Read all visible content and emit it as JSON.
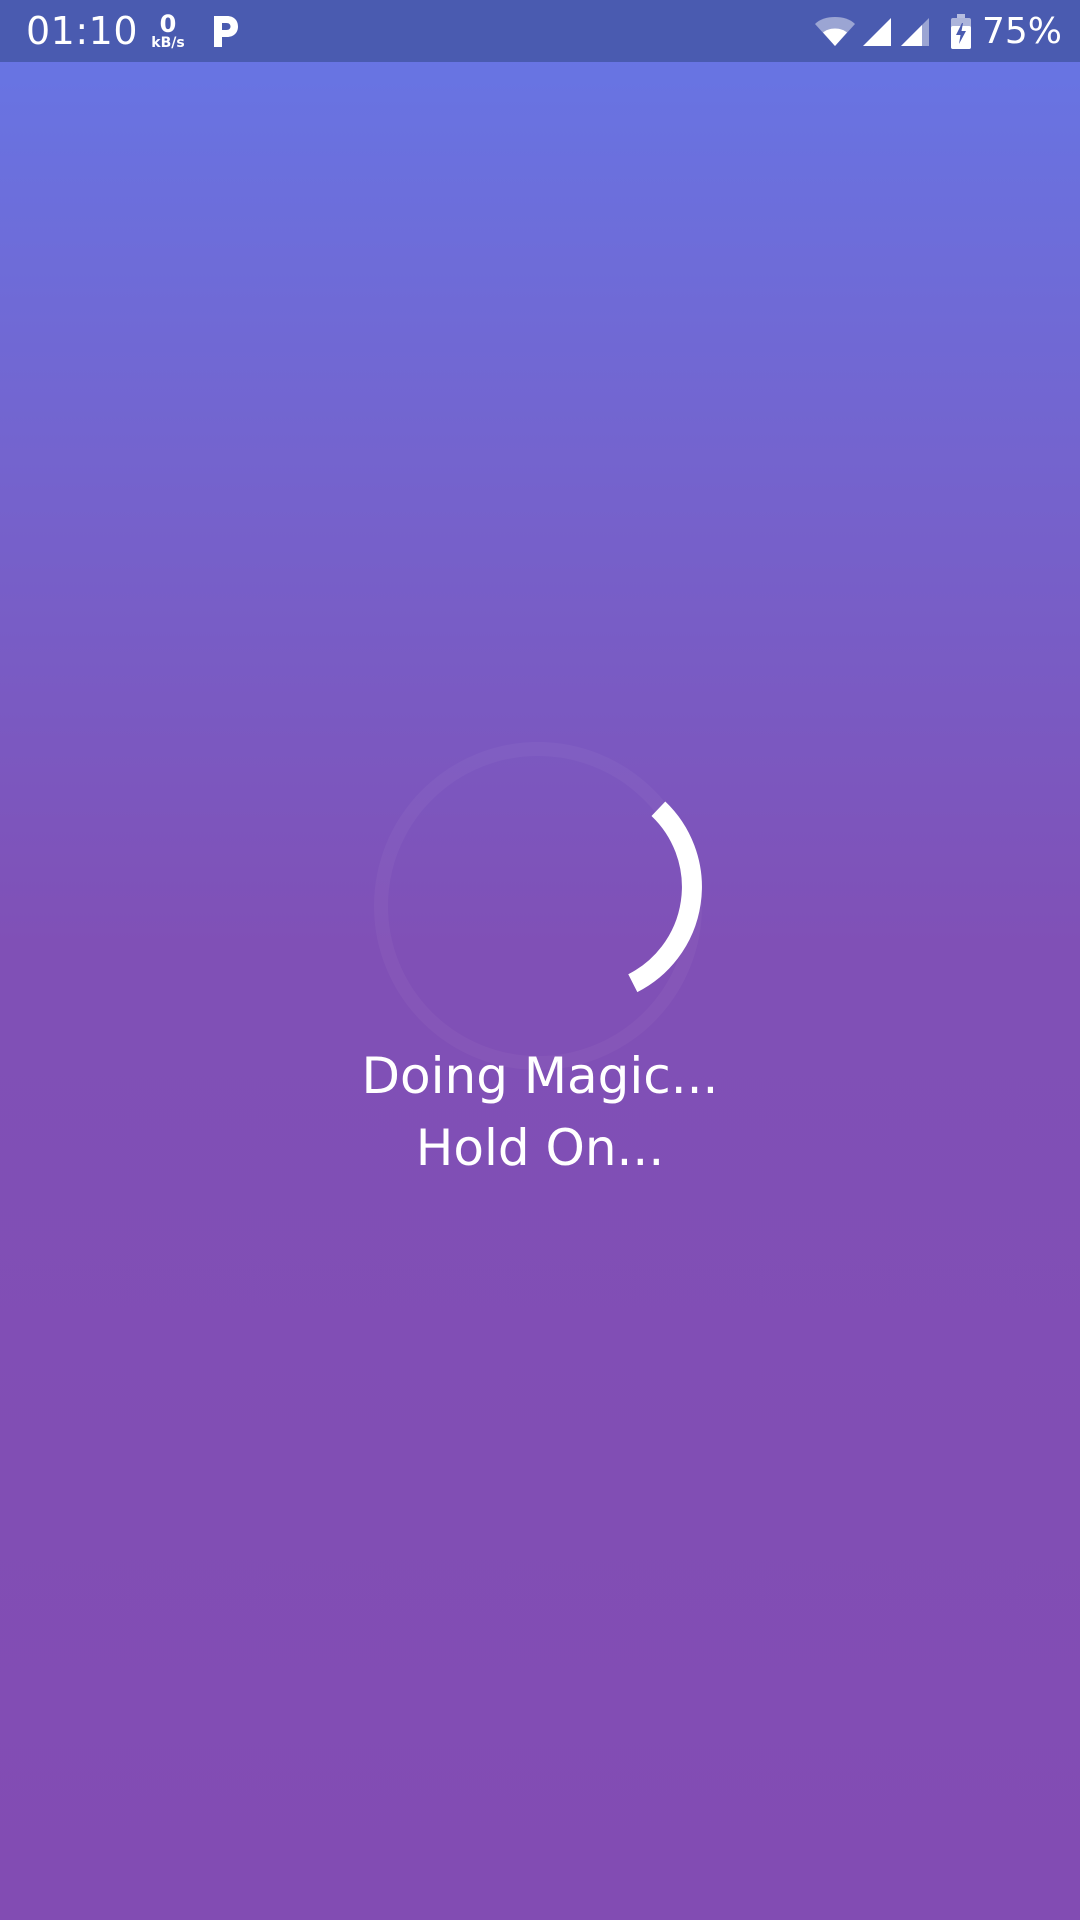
{
  "status_bar": {
    "time": "01:10",
    "net_speed_value": "0",
    "net_speed_unit": "kB/s",
    "notification_icon": "p-icon",
    "wifi_icon": "wifi-icon",
    "signal_icons": [
      "signal-icon",
      "signal-icon"
    ],
    "battery_icon": "battery-charging-icon",
    "battery_percent": "75%"
  },
  "loader": {
    "line1": "Doing Magic...",
    "line2": "Hold On...",
    "spinner_icon": "loading-spinner-icon"
  },
  "colors": {
    "status_bar_bg": "#4a5bb0",
    "gradient_top": "#6677e6",
    "gradient_bottom": "#824cb3",
    "text": "#ffffff"
  }
}
